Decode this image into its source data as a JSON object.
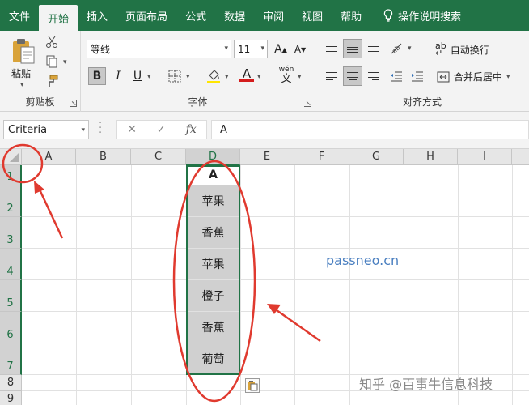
{
  "ribbon_tabs": [
    "文件",
    "开始",
    "插入",
    "页面布局",
    "公式",
    "数据",
    "审阅",
    "视图",
    "帮助"
  ],
  "tell_me": "操作说明搜索",
  "clipboard": {
    "paste_label": "粘贴",
    "group_label": "剪贴板"
  },
  "font": {
    "name": "等线",
    "size": "11",
    "grow": "A",
    "shrink": "A",
    "bold": "B",
    "italic": "I",
    "underline": "U",
    "color_letter": "A",
    "wen": "wén",
    "group_label": "字体",
    "color_red": "#d41c1c",
    "highlight_yellow": "#ffe600"
  },
  "alignment": {
    "wrap_text": "自动换行",
    "merge_center": "合并后居中",
    "group_label": "对齐方式",
    "ab": "ab"
  },
  "formula_bar": {
    "name_box": "Criteria",
    "cancel": "✕",
    "enter": "✓",
    "fx": "fx",
    "value": "A"
  },
  "columns": [
    "A",
    "B",
    "C",
    "D",
    "E",
    "F",
    "G",
    "H",
    "I"
  ],
  "rows": [
    "1",
    "2",
    "3",
    "4",
    "5",
    "6",
    "7",
    "8",
    "9"
  ],
  "column_d_values": [
    "A",
    "苹果",
    "香蕉",
    "苹果",
    "橙子",
    "香蕉",
    "葡萄"
  ],
  "watermark": "passneo.cn",
  "credit": "知乎 @百事牛信息科技",
  "colors": {
    "excel_green": "#217346",
    "annotation_red": "#e03a2f"
  }
}
